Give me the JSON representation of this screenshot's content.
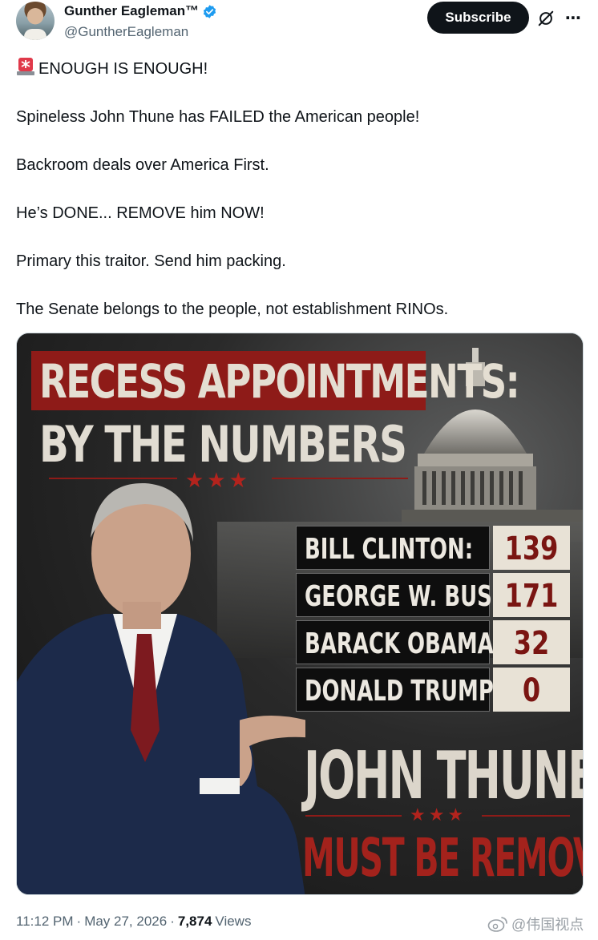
{
  "author": {
    "display_name": "Gunther Eagleman™",
    "handle": "@GuntherEagleman"
  },
  "actions": {
    "subscribe_label": "Subscribe",
    "more_icon": "⋯"
  },
  "tweet": {
    "paragraphs": [
      "ENOUGH IS ENOUGH!",
      "Spineless John Thune has FAILED the American people!",
      "Backroom deals over America First.",
      "He’s DONE... REMOVE him NOW!",
      "Primary this traitor. Send him packing.",
      "The Senate belongs to the people, not establishment RINOs."
    ]
  },
  "image": {
    "title_line1": "RECESS APPOINTMENTS:",
    "title_line2": "BY THE NUMBERS",
    "stars": "★★★",
    "rows": [
      {
        "name": "BILL CLINTON:",
        "value": "139"
      },
      {
        "name": "GEORGE W. BUSH:",
        "value": "171"
      },
      {
        "name": "BARACK OBAMA:",
        "value": "32"
      },
      {
        "name": "DONALD TRUMP:",
        "value": "0"
      }
    ],
    "headline": "JOHN THUNE",
    "subheadline": "MUST BE REMOVED"
  },
  "meta": {
    "time": "11:12 PM",
    "sep1": "·",
    "date": "May 27, 2026",
    "sep2": "·",
    "views_count": "7,874",
    "views_label": "Views"
  },
  "watermark": {
    "text": "@伟国视点"
  },
  "colors": {
    "brand_dark": "#0f1419",
    "muted": "#536471",
    "verified": "#1d9bf0",
    "banner_red": "#8e1b18"
  }
}
